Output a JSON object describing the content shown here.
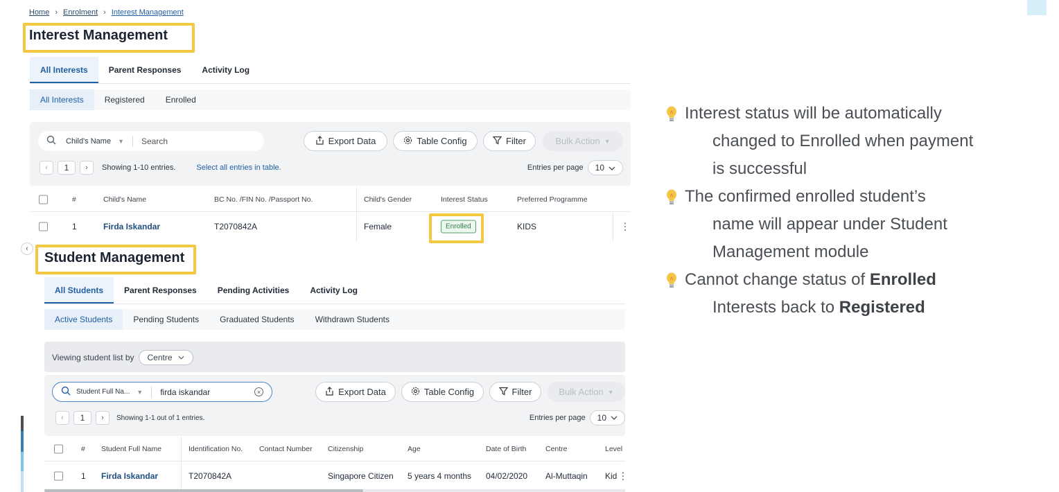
{
  "breadcrumb": {
    "home": "Home",
    "sep": "›",
    "enrolment": "Enrolment",
    "current": "Interest Management"
  },
  "interest": {
    "title": "Interest Management",
    "tabs": [
      "All Interests",
      "Parent Responses",
      "Activity Log"
    ],
    "subtabs": [
      "All Interests",
      "Registered",
      "Enrolled"
    ],
    "search_field": "Child's Name",
    "search_placeholder": "Search",
    "buttons": {
      "export": "Export Data",
      "config": "Table Config",
      "filter": "Filter",
      "bulk": "Bulk Action"
    },
    "page": "1",
    "showing": "Showing 1-10 entries.",
    "select_all": "Select all entries in table.",
    "entries_label": "Entries per page",
    "entries_value": "10",
    "columns": [
      "#",
      "Child's Name",
      "BC No. /FIN No. /Passport No.",
      "Child's Gender",
      "Interest Status",
      "Preferred Programme"
    ],
    "row": {
      "num": "1",
      "name": "Firda Iskandar",
      "id": "T2070842A",
      "gender": "Female",
      "status": "Enrolled",
      "programme": "KIDS"
    }
  },
  "student": {
    "title": "Student Management",
    "tabs": [
      "All Students",
      "Parent Responses",
      "Pending Activities",
      "Activity Log"
    ],
    "subtabs": [
      "Active Students",
      "Pending Students",
      "Graduated Students",
      "Withdrawn Students"
    ],
    "viewing_label": "Viewing student list by",
    "viewing_value": "Centre",
    "search_field": "Student Full Na...",
    "search_value": "firda iskandar",
    "buttons": {
      "export": "Export Data",
      "config": "Table Config",
      "filter": "Filter",
      "bulk": "Bulk Action"
    },
    "page": "1",
    "showing": "Showing 1-1 out of 1 entries.",
    "entries_label": "Entries per page",
    "entries_value": "10",
    "columns": [
      "#",
      "Student Full Name",
      "Identification No.",
      "Contact Number",
      "Citizenship",
      "Age",
      "Date of Birth",
      "Centre",
      "Level"
    ],
    "row": {
      "num": "1",
      "name": "Firda Iskandar",
      "id": "T2070842A",
      "contact": "",
      "citizenship": "Singapore Citizen",
      "age": "5 years 4 months",
      "dob": "04/02/2020",
      "centre": "Al-Muttaqin",
      "level": "Kid"
    }
  },
  "notes": {
    "n1_l1": "Interest status will be automatically",
    "n1_l2": "changed to Enrolled when payment",
    "n1_l3": "is successful",
    "n2_l1": "The confirmed enrolled student’s",
    "n2_l2": "name will appear under Student",
    "n2_l3": "Management module",
    "n3_a": "Cannot change status of ",
    "n3_b": "Enrolled",
    "n3_c": "Interests back to ",
    "n3_d": "Registered"
  },
  "colors": {
    "highlight": "#f5c842",
    "accent": "#1f5fa3",
    "bulb": "#f3c548"
  }
}
